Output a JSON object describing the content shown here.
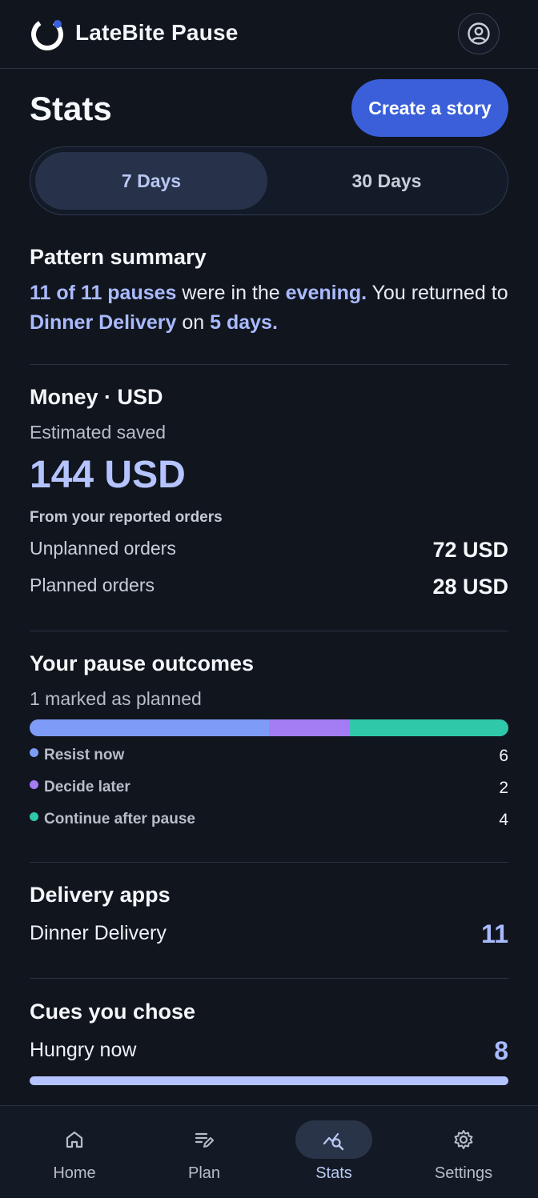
{
  "header": {
    "app_title": "LateBite Pause",
    "profile_icon": "account-circle-icon"
  },
  "page": {
    "title": "Stats",
    "create_story_label": "Create a story"
  },
  "range_tabs": [
    {
      "label": "7 Days",
      "active": true
    },
    {
      "label": "30 Days",
      "active": false
    }
  ],
  "pattern_summary": {
    "title": "Pattern summary",
    "part1": "11 of 11 pauses",
    "part2": " were in the ",
    "part3": "evening.",
    "part4": " You returned to ",
    "part5": "Dinner Delivery",
    "part6": " on ",
    "part7": "5 days."
  },
  "money": {
    "title": "Money · USD",
    "estimated_label": "Estimated saved",
    "amount": "144 USD",
    "source_note": "From your reported orders",
    "rows": [
      {
        "label": "Unplanned orders",
        "value": "72 USD"
      },
      {
        "label": "Planned orders",
        "value": "28 USD"
      }
    ]
  },
  "outcomes": {
    "title": "Your pause outcomes",
    "subtitle": "1 marked as planned",
    "items": [
      {
        "label": "Resist now",
        "count": 6,
        "color": "#7e9cf7"
      },
      {
        "label": "Decide later",
        "count": 2,
        "color": "#a47cf4"
      },
      {
        "label": "Continue after pause",
        "count": 4,
        "color": "#2fc9aa"
      }
    ]
  },
  "delivery_apps": {
    "title": "Delivery apps",
    "items": [
      {
        "label": "Dinner Delivery",
        "value": "11"
      }
    ]
  },
  "cues": {
    "title": "Cues you chose",
    "items": [
      {
        "label": "Hungry now",
        "value": "8",
        "fill_fraction": 1.0
      }
    ]
  },
  "bottom_nav": [
    {
      "label": "Home",
      "icon": "home-icon",
      "active": false
    },
    {
      "label": "Plan",
      "icon": "edit-list-icon",
      "active": false
    },
    {
      "label": "Stats",
      "icon": "insights-icon",
      "active": true
    },
    {
      "label": "Settings",
      "icon": "gear-icon",
      "active": false
    }
  ],
  "colors": {
    "accent": "#3a5fd9",
    "highlight": "#a9bbff",
    "background": "#11151e"
  }
}
